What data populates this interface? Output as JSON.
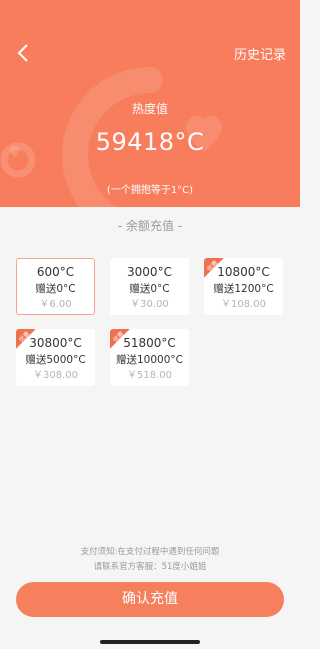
{
  "header": {
    "history_label": "历史记录"
  },
  "heat": {
    "label": "热度值",
    "value": "59418°C",
    "note": "(一个拥抱等于1°C)"
  },
  "section_title": "- 余额充值 -",
  "packages": [
    {
      "amount": "600°C",
      "gift": "赠送0°C",
      "price": "￥6.00",
      "badge": "",
      "selected": true
    },
    {
      "amount": "3000°C",
      "gift": "赠送0°C",
      "price": "￥30.00",
      "badge": "",
      "selected": false
    },
    {
      "amount": "10800°C",
      "gift": "赠送1200°C",
      "price": "￥108.00",
      "badge": "优惠",
      "selected": false
    },
    {
      "amount": "30800°C",
      "gift": "赠送5000°C",
      "price": "￥308.00",
      "badge": "优惠",
      "selected": false
    },
    {
      "amount": "51800°C",
      "gift": "赠送10000°C",
      "price": "￥518.00",
      "badge": "优惠",
      "selected": false
    }
  ],
  "notice": {
    "line1": "支付须知:在支付过程中遇到任何问题",
    "line2": "请联系官方客服：51度小姐姐"
  },
  "confirm_label": "确认充值",
  "colors": {
    "accent": "#f77d5c",
    "button": "#f6805d",
    "selected_border": "#f4a58b",
    "badge": "#f0714f"
  }
}
